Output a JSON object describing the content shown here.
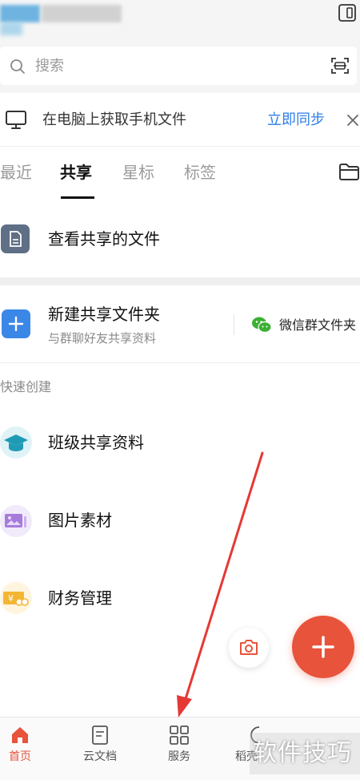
{
  "search": {
    "placeholder": "搜索"
  },
  "sync_banner": {
    "text": "在电脑上获取手机文件",
    "action": "立即同步"
  },
  "tabs": [
    {
      "label": "最近",
      "active": false
    },
    {
      "label": "共享",
      "active": true
    },
    {
      "label": "星标",
      "active": false
    },
    {
      "label": "标签",
      "active": false
    }
  ],
  "shared_files": {
    "label": "查看共享的文件"
  },
  "new_folder": {
    "title": "新建共享文件夹",
    "subtitle": "与群聊好友共享资料"
  },
  "wechat_folder": {
    "label": "微信群文件夹"
  },
  "quick_create": {
    "heading": "快速创建",
    "items": [
      {
        "label": "班级共享资料",
        "icon": "graduation-cap-icon"
      },
      {
        "label": "图片素材",
        "icon": "image-icon"
      },
      {
        "label": "财务管理",
        "icon": "money-icon"
      }
    ]
  },
  "bottom_nav": [
    {
      "label": "首页",
      "icon": "home-icon",
      "active": true
    },
    {
      "label": "云文档",
      "icon": "document-icon",
      "active": false
    },
    {
      "label": "服务",
      "icon": "grid-icon",
      "active": false
    },
    {
      "label": "稻壳",
      "icon": "shell-icon",
      "active": false
    }
  ],
  "watermark": "软件技巧",
  "colors": {
    "accent": "#e8533b",
    "link": "#2e7ee6",
    "plus_tile": "#3b87e8",
    "arrow": "#e53935"
  }
}
